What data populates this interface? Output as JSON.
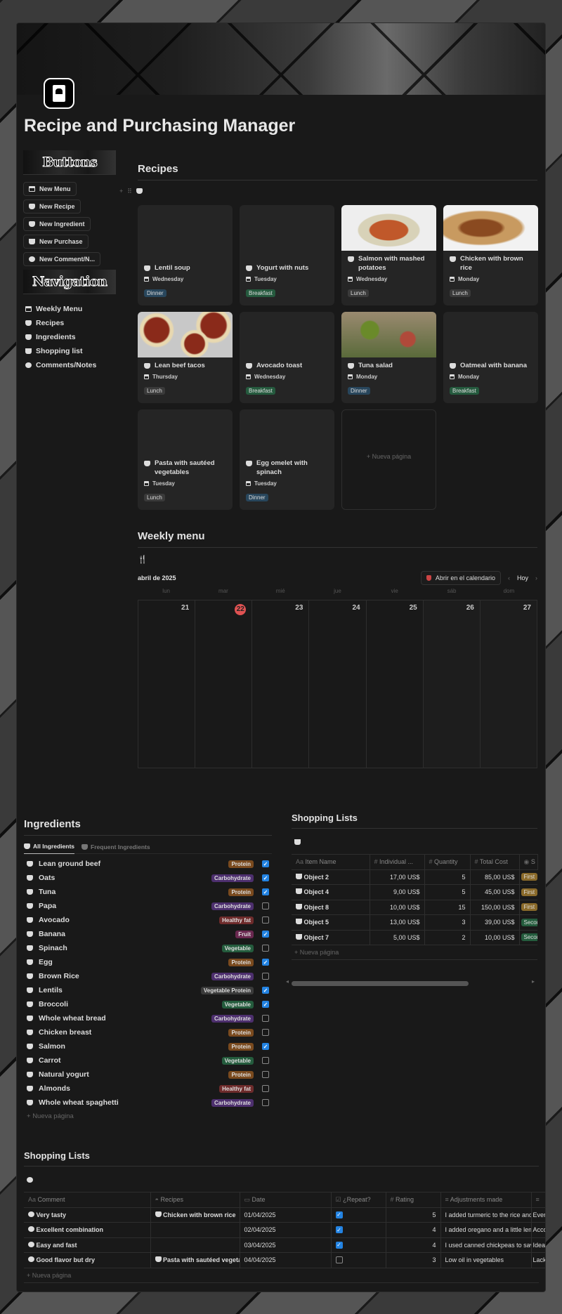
{
  "title": "Recipe and Purchasing Manager",
  "sidebar": {
    "buttons_banner": "Buttons",
    "buttons": [
      {
        "label": "New Menu",
        "icon": "calendar-icon"
      },
      {
        "label": "New Recipe",
        "icon": "bowl-icon"
      },
      {
        "label": "New Ingredient",
        "icon": "ingredient-icon"
      },
      {
        "label": "New Purchase",
        "icon": "basket-icon"
      },
      {
        "label": "New Comment/N...",
        "icon": "comment-icon"
      }
    ],
    "navigation_banner": "Navigation",
    "nav": [
      {
        "label": "Weekly Menu",
        "icon": "calendar-icon"
      },
      {
        "label": "Recipes",
        "icon": "bowl-icon"
      },
      {
        "label": "Ingredients",
        "icon": "ingredient-icon"
      },
      {
        "label": "Shopping list",
        "icon": "basket-icon"
      },
      {
        "label": "Comments/Notes",
        "icon": "comment-icon"
      }
    ]
  },
  "recipes": {
    "heading": "Recipes",
    "cards": [
      {
        "name": "Lentil soup",
        "day": "Wednesday",
        "tag": "Dinner",
        "color": "#28465c"
      },
      {
        "name": "Yogurt with nuts",
        "day": "Tuesday",
        "tag": "Breakfast",
        "color": "#255a3e"
      },
      {
        "name": "Salmon with mashed potatoes",
        "day": "Wednesday",
        "tag": "Lunch",
        "color": "#3a3a3a",
        "image": "salmon"
      },
      {
        "name": "Chicken with brown rice",
        "day": "Monday",
        "tag": "Lunch",
        "color": "#3a3a3a",
        "image": "chicken"
      },
      {
        "name": "Lean beef tacos",
        "day": "Thursday",
        "tag": "Lunch",
        "color": "#3a3a3a",
        "image": "tacos"
      },
      {
        "name": "Avocado toast",
        "day": "Wednesday",
        "tag": "Breakfast",
        "color": "#255a3e"
      },
      {
        "name": "Tuna salad",
        "day": "Monday",
        "tag": "Dinner",
        "color": "#28465c",
        "image": "salad"
      },
      {
        "name": "Oatmeal with banana",
        "day": "Monday",
        "tag": "Breakfast",
        "color": "#255a3e"
      },
      {
        "name": "Pasta with sautéed vegetables",
        "day": "Tuesday",
        "tag": "Lunch",
        "color": "#3a3a3a"
      },
      {
        "name": "Egg omelet with spinach",
        "day": "Tuesday",
        "tag": "Dinner",
        "color": "#28465c"
      }
    ],
    "new_page": "+ Nueva página"
  },
  "weekly": {
    "heading": "Weekly menu",
    "month": "abril de 2025",
    "open_calendar": "Abrir en el calendario",
    "today": "Hoy",
    "days": [
      "lun",
      "mar",
      "mié",
      "jue",
      "vie",
      "sáb",
      "dom"
    ],
    "dates": [
      "21",
      "22",
      "23",
      "24",
      "25",
      "26",
      "27"
    ],
    "today_index": 1
  },
  "ingredients": {
    "heading": "Ingredients",
    "tabs": [
      "All Ingredients",
      "Frequent Ingredients"
    ],
    "items": [
      {
        "name": "Lean ground beef",
        "tag": "Protein",
        "checked": true
      },
      {
        "name": "Oats",
        "tag": "Carbohydrate",
        "checked": true
      },
      {
        "name": "Tuna",
        "tag": "Protein",
        "checked": true
      },
      {
        "name": "Papa",
        "tag": "Carbohydrate",
        "checked": false
      },
      {
        "name": "Avocado",
        "tag": "Healthy fat",
        "checked": false
      },
      {
        "name": "Banana",
        "tag": "Fruit",
        "checked": true
      },
      {
        "name": "Spinach",
        "tag": "Vegetable",
        "checked": false
      },
      {
        "name": "Egg",
        "tag": "Protein",
        "checked": true
      },
      {
        "name": "Brown Rice",
        "tag": "Carbohydrate",
        "checked": false
      },
      {
        "name": "Lentils",
        "tag": "Vegetable Protein",
        "checked": true
      },
      {
        "name": "Broccoli",
        "tag": "Vegetable",
        "checked": true
      },
      {
        "name": "Whole wheat bread",
        "tag": "Carbohydrate",
        "checked": false
      },
      {
        "name": "Chicken breast",
        "tag": "Protein",
        "checked": false
      },
      {
        "name": "Salmon",
        "tag": "Protein",
        "checked": true
      },
      {
        "name": "Carrot",
        "tag": "Vegetable",
        "checked": false
      },
      {
        "name": "Natural yogurt",
        "tag": "Protein",
        "checked": false
      },
      {
        "name": "Almonds",
        "tag": "Healthy fat",
        "checked": false
      },
      {
        "name": "Whole wheat spaghetti",
        "tag": "Carbohydrate",
        "checked": false
      }
    ],
    "tag_colors": {
      "Protein": "#7a4a1e",
      "Carbohydrate": "#4d2f6e",
      "Healthy fat": "#6e2b2b",
      "Fruit": "#6a2850",
      "Vegetable": "#245c3d",
      "Vegetable Protein": "#3a3a3a"
    },
    "new_page": "Nueva página"
  },
  "shopping": {
    "heading": "Shopping Lists",
    "columns": [
      "Item Name",
      "Individual ...",
      "Quantity",
      "Total Cost",
      "S"
    ],
    "rows": [
      {
        "item": "Object 2",
        "price": "17,00 US$",
        "qty": "5",
        "total": "85,00 US$",
        "status": "First",
        "color": "#8a6a2a"
      },
      {
        "item": "Object 4",
        "price": "9,00 US$",
        "qty": "5",
        "total": "45,00 US$",
        "status": "First",
        "color": "#8a6a2a"
      },
      {
        "item": "Object 8",
        "price": "10,00 US$",
        "qty": "15",
        "total": "150,00 US$",
        "status": "First",
        "color": "#8a6a2a"
      },
      {
        "item": "Object 5",
        "price": "13,00 US$",
        "qty": "3",
        "total": "39,00 US$",
        "status": "Second",
        "color": "#245c3d"
      },
      {
        "item": "Object 7",
        "price": "5,00 US$",
        "qty": "2",
        "total": "10,00 US$",
        "status": "Second",
        "color": "#245c3d"
      }
    ],
    "new_page": "Nueva página"
  },
  "comments": {
    "heading": "Shopping Lists",
    "columns": [
      "Comment",
      "Recipes",
      "Date",
      "¿Repeat?",
      "Rating",
      "Adjustments made"
    ],
    "rows": [
      {
        "comment": "Very tasty",
        "recipe": "Chicken with brown rice",
        "date": "01/04/2025",
        "repeat": true,
        "rating": "5",
        "adjust": "I added turmeric to the rice and",
        "extra": "Every"
      },
      {
        "comment": "Excellent combination",
        "recipe": "",
        "date": "02/04/2025",
        "repeat": true,
        "rating": "4",
        "adjust": "I added oregano and a little lem",
        "extra": "Acco"
      },
      {
        "comment": "Easy and fast",
        "recipe": "",
        "date": "03/04/2025",
        "repeat": true,
        "rating": "4",
        "adjust": "I used canned chickpeas to save",
        "extra": "Idea"
      },
      {
        "comment": "Good flavor but dry",
        "recipe": "Pasta with sautéed vegetables",
        "date": "04/04/2025",
        "repeat": false,
        "rating": "3",
        "adjust": "Low oil in vegetables",
        "extra": "Lack"
      }
    ],
    "new_page": "Nueva página"
  }
}
